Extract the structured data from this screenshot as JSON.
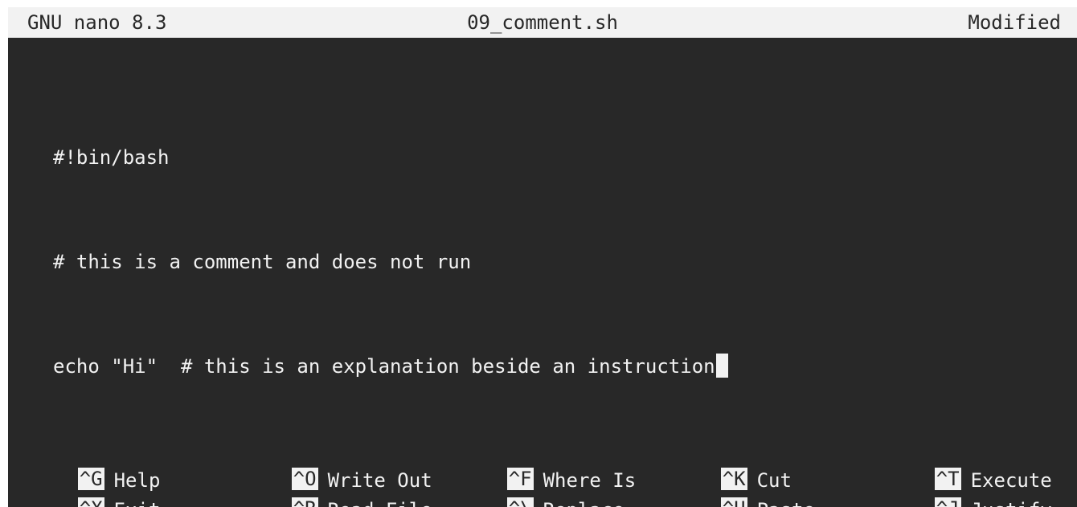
{
  "titlebar": {
    "app": "GNU nano 8.3",
    "filename": "09_comment.sh",
    "status": "Modified"
  },
  "editor": {
    "lines": [
      "#!bin/bash",
      "# this is a comment and does not run",
      "echo \"Hi\"  # this is an explanation beside an instruction"
    ]
  },
  "shortcuts": {
    "row1": [
      {
        "key": "^G",
        "label": "Help"
      },
      {
        "key": "^O",
        "label": "Write Out"
      },
      {
        "key": "^F",
        "label": "Where Is"
      },
      {
        "key": "^K",
        "label": "Cut"
      },
      {
        "key": "^T",
        "label": "Execute"
      }
    ],
    "row2": [
      {
        "key": "^X",
        "label": "Exit"
      },
      {
        "key": "^R",
        "label": "Read File"
      },
      {
        "key": "^\\",
        "label": "Replace"
      },
      {
        "key": "^U",
        "label": "Paste"
      },
      {
        "key": "^J",
        "label": "Justify"
      }
    ]
  },
  "colors": {
    "background": "#282828",
    "foreground": "#f2f2f2"
  }
}
